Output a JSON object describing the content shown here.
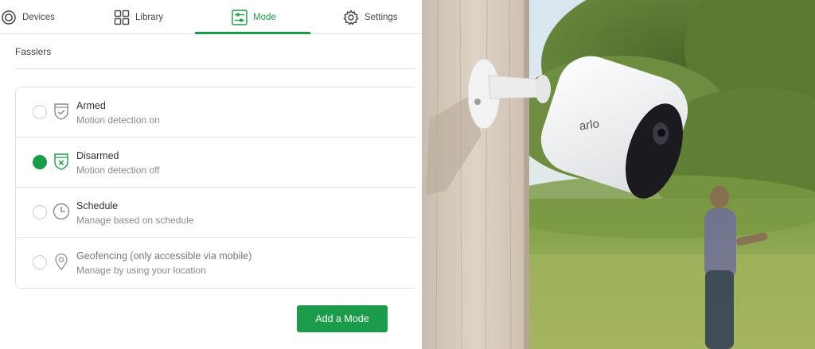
{
  "nav": {
    "items": [
      {
        "label": "Devices",
        "icon": "devices-icon"
      },
      {
        "label": "Library",
        "icon": "library-grid-icon"
      },
      {
        "label": "Mode",
        "icon": "sliders-icon",
        "active": true
      },
      {
        "label": "Settings",
        "icon": "gear-icon"
      }
    ]
  },
  "location_name": "Fasslers",
  "modes": [
    {
      "title": "Armed",
      "description": "Motion detection on",
      "icon": "shield-check-icon",
      "selected": false
    },
    {
      "title": "Disarmed",
      "description": "Motion detection off",
      "icon": "shield-x-icon",
      "selected": true
    },
    {
      "title": "Schedule",
      "description": "Manage based on schedule",
      "icon": "clock-icon",
      "selected": false
    },
    {
      "title": "Geofencing (only accessible via mobile)",
      "description": "Manage by using your location",
      "icon": "location-pin-icon",
      "selected": false
    }
  ],
  "add_mode_label": "Add a Mode",
  "photo": {
    "camera_brand": "arlo"
  },
  "colors": {
    "accent": "#1a9c4a",
    "text": "#333333",
    "muted": "#8a8a8a"
  }
}
